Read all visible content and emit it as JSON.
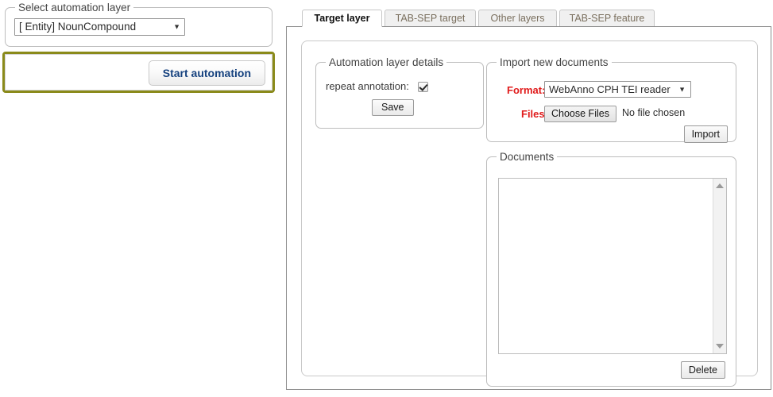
{
  "left_panel": {
    "select_layer_legend": "Select automation layer",
    "layer_select": {
      "value": "[ Entity] NounCompound",
      "caret": "▼"
    },
    "start_automation_label": "Start automation",
    "accent_border_color": "#8a8a1a",
    "start_button_text_color": "#15417e"
  },
  "tabs": [
    {
      "label": "Target layer",
      "active": true
    },
    {
      "label": "TAB-SEP target",
      "active": false
    },
    {
      "label": "Other layers",
      "active": false
    },
    {
      "label": "TAB-SEP feature",
      "active": false
    }
  ],
  "automation_details": {
    "legend": "Automation layer details",
    "repeat_annotation_label": "repeat annotation:",
    "repeat_annotation_checked": true,
    "save_label": "Save"
  },
  "import_documents": {
    "legend": "Import new documents",
    "format_label": "Format:",
    "format_value": "WebAnno CPH TEI reader",
    "format_caret": "▼",
    "files_label": "Files:",
    "choose_files_label": "Choose Files",
    "no_file_chosen": "No file chosen",
    "import_label": "Import",
    "label_color": "#e01b1b"
  },
  "documents": {
    "legend": "Documents",
    "items": [],
    "delete_label": "Delete"
  }
}
